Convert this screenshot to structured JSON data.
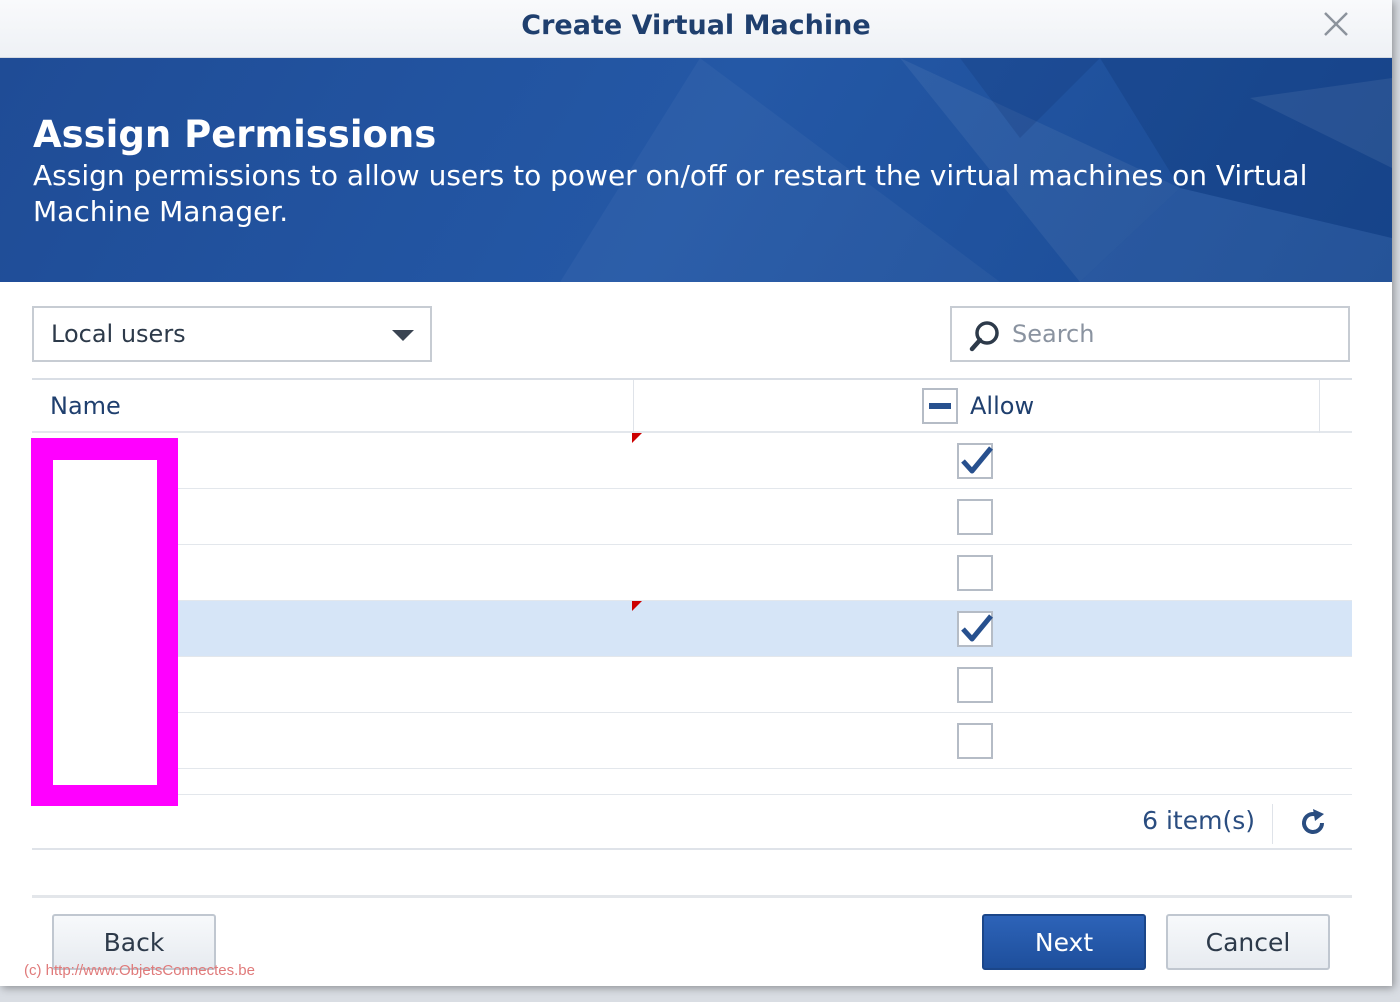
{
  "dialog": {
    "title": "Create Virtual Machine"
  },
  "banner": {
    "title": "Assign Permissions",
    "description": "Assign permissions to allow users to power on/off or restart the virtual machines on Virtual Machine Manager."
  },
  "filter": {
    "selected": "Local users"
  },
  "search": {
    "placeholder": "Search",
    "value": ""
  },
  "grid": {
    "columns": {
      "name": "Name",
      "allow": "Allow"
    },
    "header_allow_state": "partial",
    "rows": [
      {
        "name": "",
        "allowed": true,
        "selected": false,
        "modified": true
      },
      {
        "name": "",
        "allowed": false,
        "selected": false,
        "modified": false
      },
      {
        "name": "",
        "allowed": false,
        "selected": false,
        "modified": false
      },
      {
        "name": "",
        "allowed": true,
        "selected": true,
        "modified": true
      },
      {
        "name": "",
        "allowed": false,
        "selected": false,
        "modified": false
      },
      {
        "name": "",
        "allowed": false,
        "selected": false,
        "modified": false
      }
    ],
    "item_count": "6 item(s)"
  },
  "buttons": {
    "back": "Back",
    "next": "Next",
    "cancel": "Cancel"
  },
  "watermark": "(c) http://www.ObjetsConnectes.be",
  "colors": {
    "accent": "#1f4c96",
    "primary_button": "#2458a6",
    "selected_row": "#d6e5f7",
    "redaction": "#ff00ff"
  }
}
